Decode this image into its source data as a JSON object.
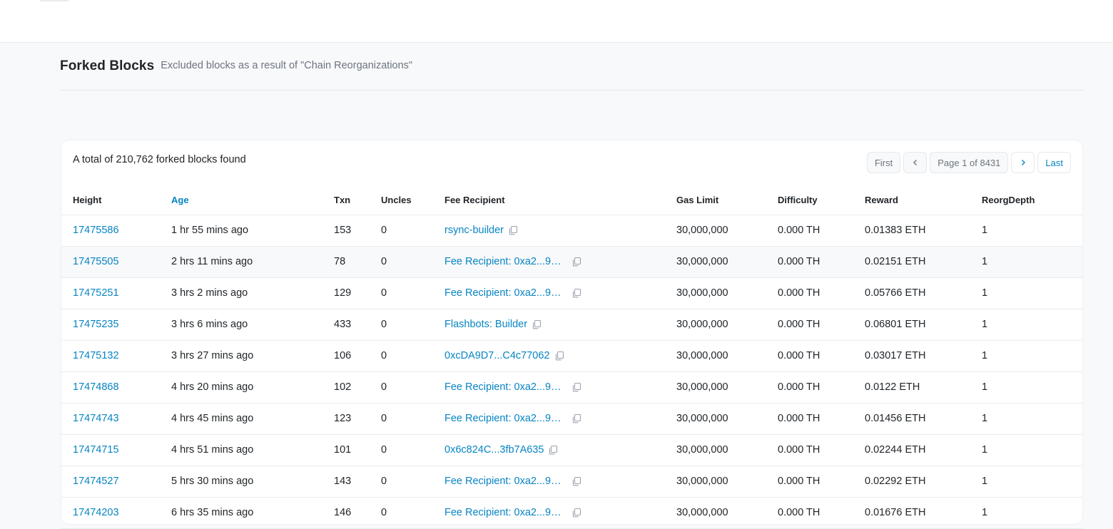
{
  "header": {
    "title": "Forked Blocks",
    "subtitle": "Excluded blocks as a result of \"Chain Reorganizations\""
  },
  "summary": {
    "total_text": "A total of 210,762 forked blocks found"
  },
  "pagination": {
    "first": "First",
    "page": "Page 1 of 8431",
    "last": "Last",
    "prev_icon": "chevron-left-icon",
    "next_icon": "chevron-right-icon"
  },
  "table": {
    "columns": [
      "Height",
      "Age",
      "Txn",
      "Uncles",
      "Fee Recipient",
      "Gas Limit",
      "Difficulty",
      "Reward",
      "ReorgDepth"
    ],
    "rows": [
      {
        "height": "17475586",
        "age": "1 hr 55 mins ago",
        "txn": "153",
        "uncles": "0",
        "fee_recipient": "rsync-builder",
        "gas_limit": "30,000,000",
        "difficulty": "0.000 TH",
        "reward": "0.01383 ETH",
        "reorg_depth": "1"
      },
      {
        "height": "17475505",
        "age": "2 hrs 11 mins ago",
        "txn": "78",
        "uncles": "0",
        "fee_recipient": "Fee Recipient: 0xa2...9…",
        "gas_limit": "30,000,000",
        "difficulty": "0.000 TH",
        "reward": "0.02151 ETH",
        "reorg_depth": "1"
      },
      {
        "height": "17475251",
        "age": "3 hrs 2 mins ago",
        "txn": "129",
        "uncles": "0",
        "fee_recipient": "Fee Recipient: 0xa2...9…",
        "gas_limit": "30,000,000",
        "difficulty": "0.000 TH",
        "reward": "0.05766 ETH",
        "reorg_depth": "1"
      },
      {
        "height": "17475235",
        "age": "3 hrs 6 mins ago",
        "txn": "433",
        "uncles": "0",
        "fee_recipient": "Flashbots: Builder",
        "gas_limit": "30,000,000",
        "difficulty": "0.000 TH",
        "reward": "0.06801 ETH",
        "reorg_depth": "1"
      },
      {
        "height": "17475132",
        "age": "3 hrs 27 mins ago",
        "txn": "106",
        "uncles": "0",
        "fee_recipient": "0xcDA9D7...C4c77062",
        "gas_limit": "30,000,000",
        "difficulty": "0.000 TH",
        "reward": "0.03017 ETH",
        "reorg_depth": "1"
      },
      {
        "height": "17474868",
        "age": "4 hrs 20 mins ago",
        "txn": "102",
        "uncles": "0",
        "fee_recipient": "Fee Recipient: 0xa2...9…",
        "gas_limit": "30,000,000",
        "difficulty": "0.000 TH",
        "reward": "0.0122 ETH",
        "reorg_depth": "1"
      },
      {
        "height": "17474743",
        "age": "4 hrs 45 mins ago",
        "txn": "123",
        "uncles": "0",
        "fee_recipient": "Fee Recipient: 0xa2...9…",
        "gas_limit": "30,000,000",
        "difficulty": "0.000 TH",
        "reward": "0.01456 ETH",
        "reorg_depth": "1"
      },
      {
        "height": "17474715",
        "age": "4 hrs 51 mins ago",
        "txn": "101",
        "uncles": "0",
        "fee_recipient": "0x6c824C...3fb7A635",
        "gas_limit": "30,000,000",
        "difficulty": "0.000 TH",
        "reward": "0.02244 ETH",
        "reorg_depth": "1"
      },
      {
        "height": "17474527",
        "age": "5 hrs 30 mins ago",
        "txn": "143",
        "uncles": "0",
        "fee_recipient": "Fee Recipient: 0xa2...9…",
        "gas_limit": "30,000,000",
        "difficulty": "0.000 TH",
        "reward": "0.02292 ETH",
        "reorg_depth": "1"
      },
      {
        "height": "17474203",
        "age": "6 hrs 35 mins ago",
        "txn": "146",
        "uncles": "0",
        "fee_recipient": "Fee Recipient: 0xa2...9…",
        "gas_limit": "30,000,000",
        "difficulty": "0.000 TH",
        "reward": "0.01676 ETH",
        "reorg_depth": "1"
      }
    ]
  },
  "colors": {
    "link": "#0784c3",
    "muted": "#6c757d",
    "text": "#212529",
    "background": "#f8f9fb"
  }
}
